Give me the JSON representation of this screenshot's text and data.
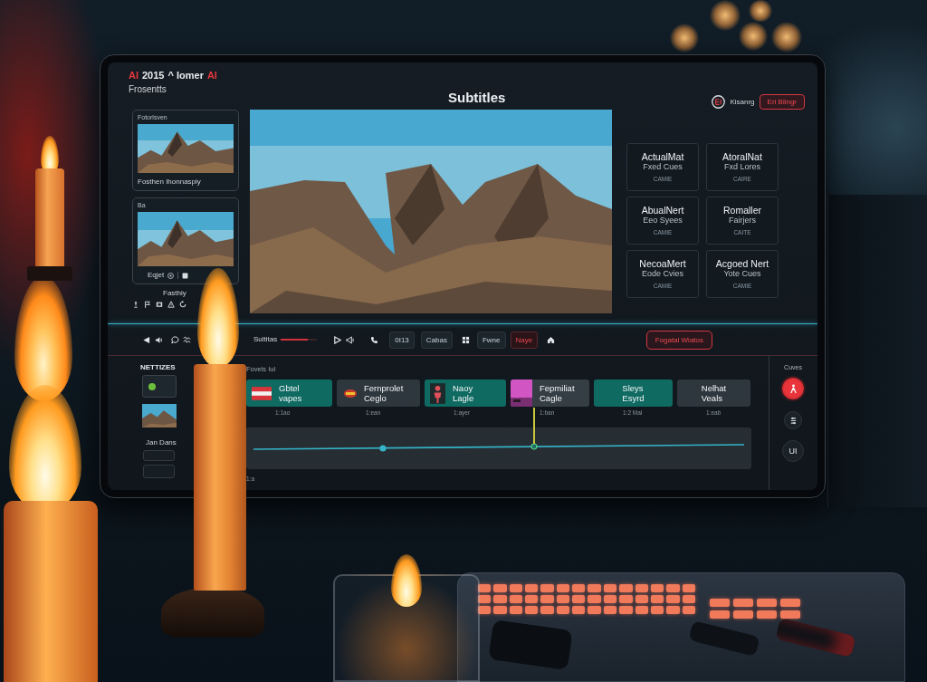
{
  "header": {
    "brand": [
      {
        "text": "AI",
        "accent": true
      },
      {
        "text": "2015",
        "accent": false
      },
      {
        "text": "^ Iomer",
        "accent": false
      },
      {
        "text": "AI",
        "accent": true
      }
    ],
    "subtitle": "Frosentts",
    "title": "Subtitles",
    "user": "Kisanrg",
    "action": "Eri Blingr"
  },
  "media_bin": {
    "items": [
      {
        "kind": "captioned",
        "label": "Fotorlsven",
        "caption": "Fosthen Ihonnaspiy"
      },
      {
        "kind": "tools",
        "label": "Ba",
        "caption": "Eqjet"
      }
    ],
    "footer": "Fasthiy"
  },
  "presets": [
    {
      "title": "ActualMat",
      "subtitle": "Fxed Cues",
      "tag": "CAMIE"
    },
    {
      "title": "AtoralNat",
      "subtitle": "Fxd Lores",
      "tag": "CAIRE"
    },
    {
      "title": "AbualNert",
      "subtitle": "Eeo Syees",
      "tag": "CAMIE"
    },
    {
      "title": "Romaller",
      "subtitle": "Fairjers",
      "tag": "CAITE"
    },
    {
      "title": "NecoaMert",
      "subtitle": "Eode Cvies",
      "tag": "CAMIE"
    },
    {
      "title": "Acgoed Nert",
      "subtitle": "Yote Cues",
      "tag": "CAMIE"
    }
  ],
  "toolbar": {
    "label": "Sultitas",
    "slider": {
      "level": 0.75
    },
    "toggles": [
      {
        "text": "0I13",
        "selected": false
      },
      {
        "text": "Cabas",
        "selected": false
      },
      {
        "text": "Fwne",
        "selected": false
      },
      {
        "text": "Naye",
        "selected": true
      }
    ],
    "export": "Fogatal Wiatos"
  },
  "timeline": {
    "sidebar": {
      "title": "NETTIZES",
      "label": "Jan Dans"
    },
    "track_label": "Fovels Iul",
    "clips": [
      {
        "kind": "flag",
        "title": "Gbtel",
        "subtitle": "vapes",
        "time": "1:1ao",
        "color": "#0f6a62"
      },
      {
        "kind": "badge",
        "title": "Fernprolet",
        "subtitle": "Ceglo",
        "time": "1:ean",
        "color": "#2e373e"
      },
      {
        "kind": "figure",
        "title": "Naoy",
        "subtitle": "Lagle",
        "time": "1:ayer",
        "color": "#0f6a62"
      },
      {
        "kind": "thumbnail",
        "title": "Fepmiliat",
        "subtitle": "Cagle",
        "time": "1:ban",
        "color": "#353e45"
      },
      {
        "kind": "text",
        "title": "Sleys",
        "subtitle": "Esyrd",
        "time": "1:2 Mal",
        "color": "#0f6a62"
      },
      {
        "kind": "text",
        "title": "Nelhat",
        "subtitle": "Veals",
        "time": "1:eab",
        "color": "#2e373e"
      }
    ],
    "playhead": {
      "level": 0.57
    },
    "end_label": "1:a"
  },
  "controls": {
    "label": "Cuves",
    "button": "UI"
  }
}
